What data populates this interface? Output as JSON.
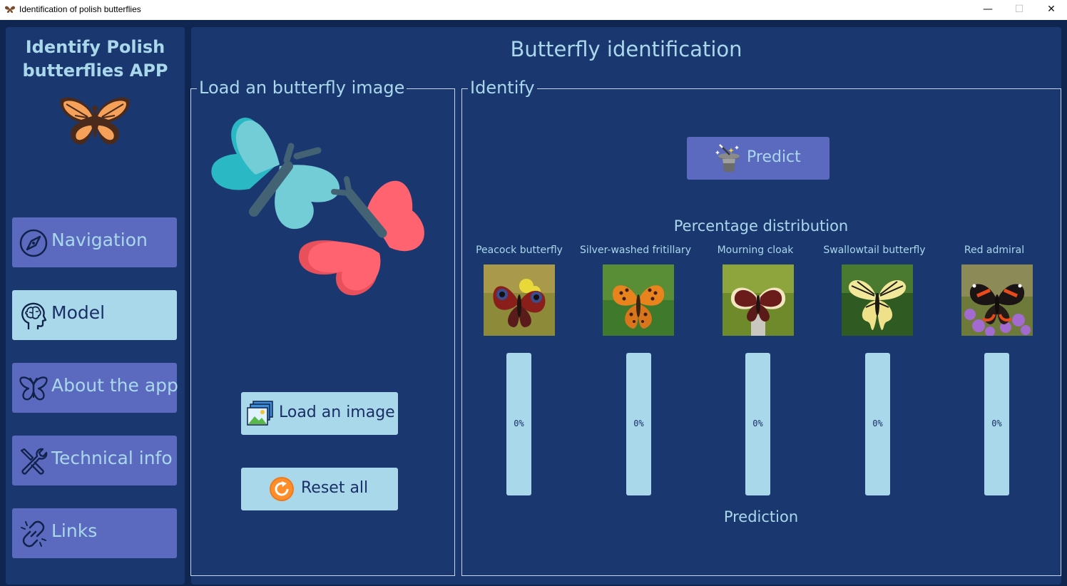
{
  "window": {
    "title": "Identification of polish butterflies",
    "minimize_glyph": "—",
    "maximize_glyph": "☐",
    "close_glyph": "✕"
  },
  "sidebar": {
    "app_title_line1": "Identify Polish",
    "app_title_line2": "butterflies APP",
    "logo_icon": "butterfly-logo-icon",
    "items": [
      {
        "label": "Navigation",
        "icon": "compass-icon",
        "active": false
      },
      {
        "label": "Model",
        "icon": "brain-head-icon",
        "active": true
      },
      {
        "label": "About the app",
        "icon": "butterfly-outline-icon",
        "active": false
      },
      {
        "label": "Technical info",
        "icon": "tools-icon",
        "active": false
      },
      {
        "label": "Links",
        "icon": "link-icon",
        "active": false
      }
    ]
  },
  "main": {
    "title": "Butterfly identification",
    "load_panel": {
      "legend": "Load an butterfly image",
      "load_button": "Load an image",
      "reset_button": "Reset all"
    },
    "identify_panel": {
      "legend": "Identify",
      "predict_button": "Predict",
      "distribution_title": "Percentage distribution",
      "prediction_label": "Prediction",
      "species": [
        {
          "name": "Peacock butterfly",
          "percent": "0%",
          "value": 0
        },
        {
          "name": "Silver-washed fritillary",
          "percent": "0%",
          "value": 0
        },
        {
          "name": "Mourning cloak",
          "percent": "0%",
          "value": 0
        },
        {
          "name": "Swallowtail butterfly",
          "percent": "0%",
          "value": 0
        },
        {
          "name": "Red admiral",
          "percent": "0%",
          "value": 0
        }
      ]
    }
  },
  "colors": {
    "window_bg": "#0f2650",
    "panel_bg": "#1b3770",
    "accent_light": "#a9d8ea",
    "button_purple": "#5b6abf",
    "dark_text": "#1a2f66"
  }
}
